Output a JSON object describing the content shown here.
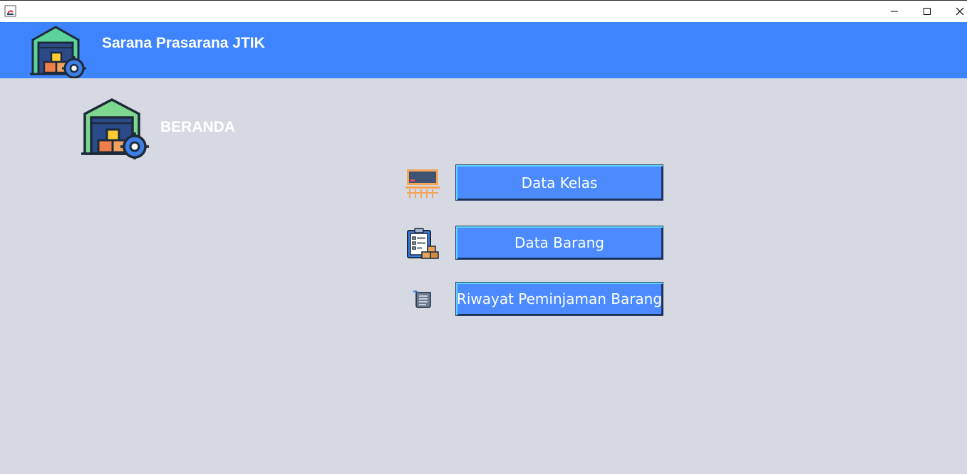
{
  "window": {
    "controls": [
      "minimize-icon",
      "maximize-icon",
      "close-icon"
    ],
    "app_icon": "java-icon"
  },
  "header": {
    "title": "Sarana Prasarana JTIK",
    "logo": "warehouse-gear-icon",
    "background": "#3d84fe"
  },
  "page": {
    "title": "BERANDA",
    "logo": "warehouse-gear-icon",
    "background": "#d6d9e1"
  },
  "menu": {
    "items": [
      {
        "label": "Data Kelas",
        "icon": "classroom-icon"
      },
      {
        "label": "Data Barang",
        "icon": "clipboard-boxes-icon"
      },
      {
        "label": "Riwayat Peminjaman Barang",
        "icon": "scroll-icon"
      }
    ],
    "button_color": "#4b8bff"
  }
}
